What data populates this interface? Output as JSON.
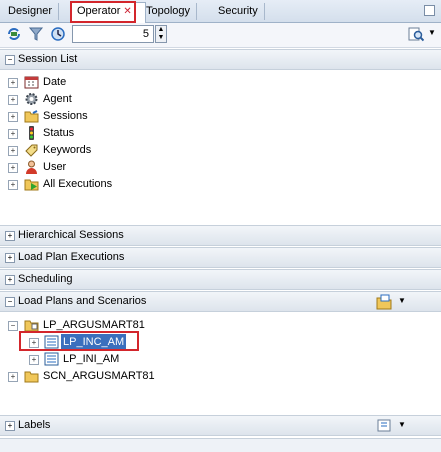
{
  "tabs": [
    {
      "label": "Designer"
    },
    {
      "label": "Operator"
    },
    {
      "label": "Topology"
    },
    {
      "label": "Security"
    }
  ],
  "toolbar": {
    "count_value": "5"
  },
  "session_list": {
    "title": "Session List",
    "items": [
      {
        "label": "Date"
      },
      {
        "label": "Agent"
      },
      {
        "label": "Sessions"
      },
      {
        "label": "Status"
      },
      {
        "label": "Keywords"
      },
      {
        "label": "User"
      },
      {
        "label": "All Executions"
      }
    ]
  },
  "sections": {
    "hierarchical": "Hierarchical Sessions",
    "load_plan_exec": "Load Plan Executions",
    "scheduling": "Scheduling",
    "load_plans": "Load Plans and Scenarios",
    "labels": "Labels"
  },
  "load_plans_tree": {
    "root": "LP_ARGUSMART81",
    "children": [
      "LP_INC_AM",
      "LP_INI_AM"
    ],
    "other": "SCN_ARGUSMART81"
  },
  "colors": {
    "accent": "#d3262c",
    "selection": "#3a6fbd"
  }
}
